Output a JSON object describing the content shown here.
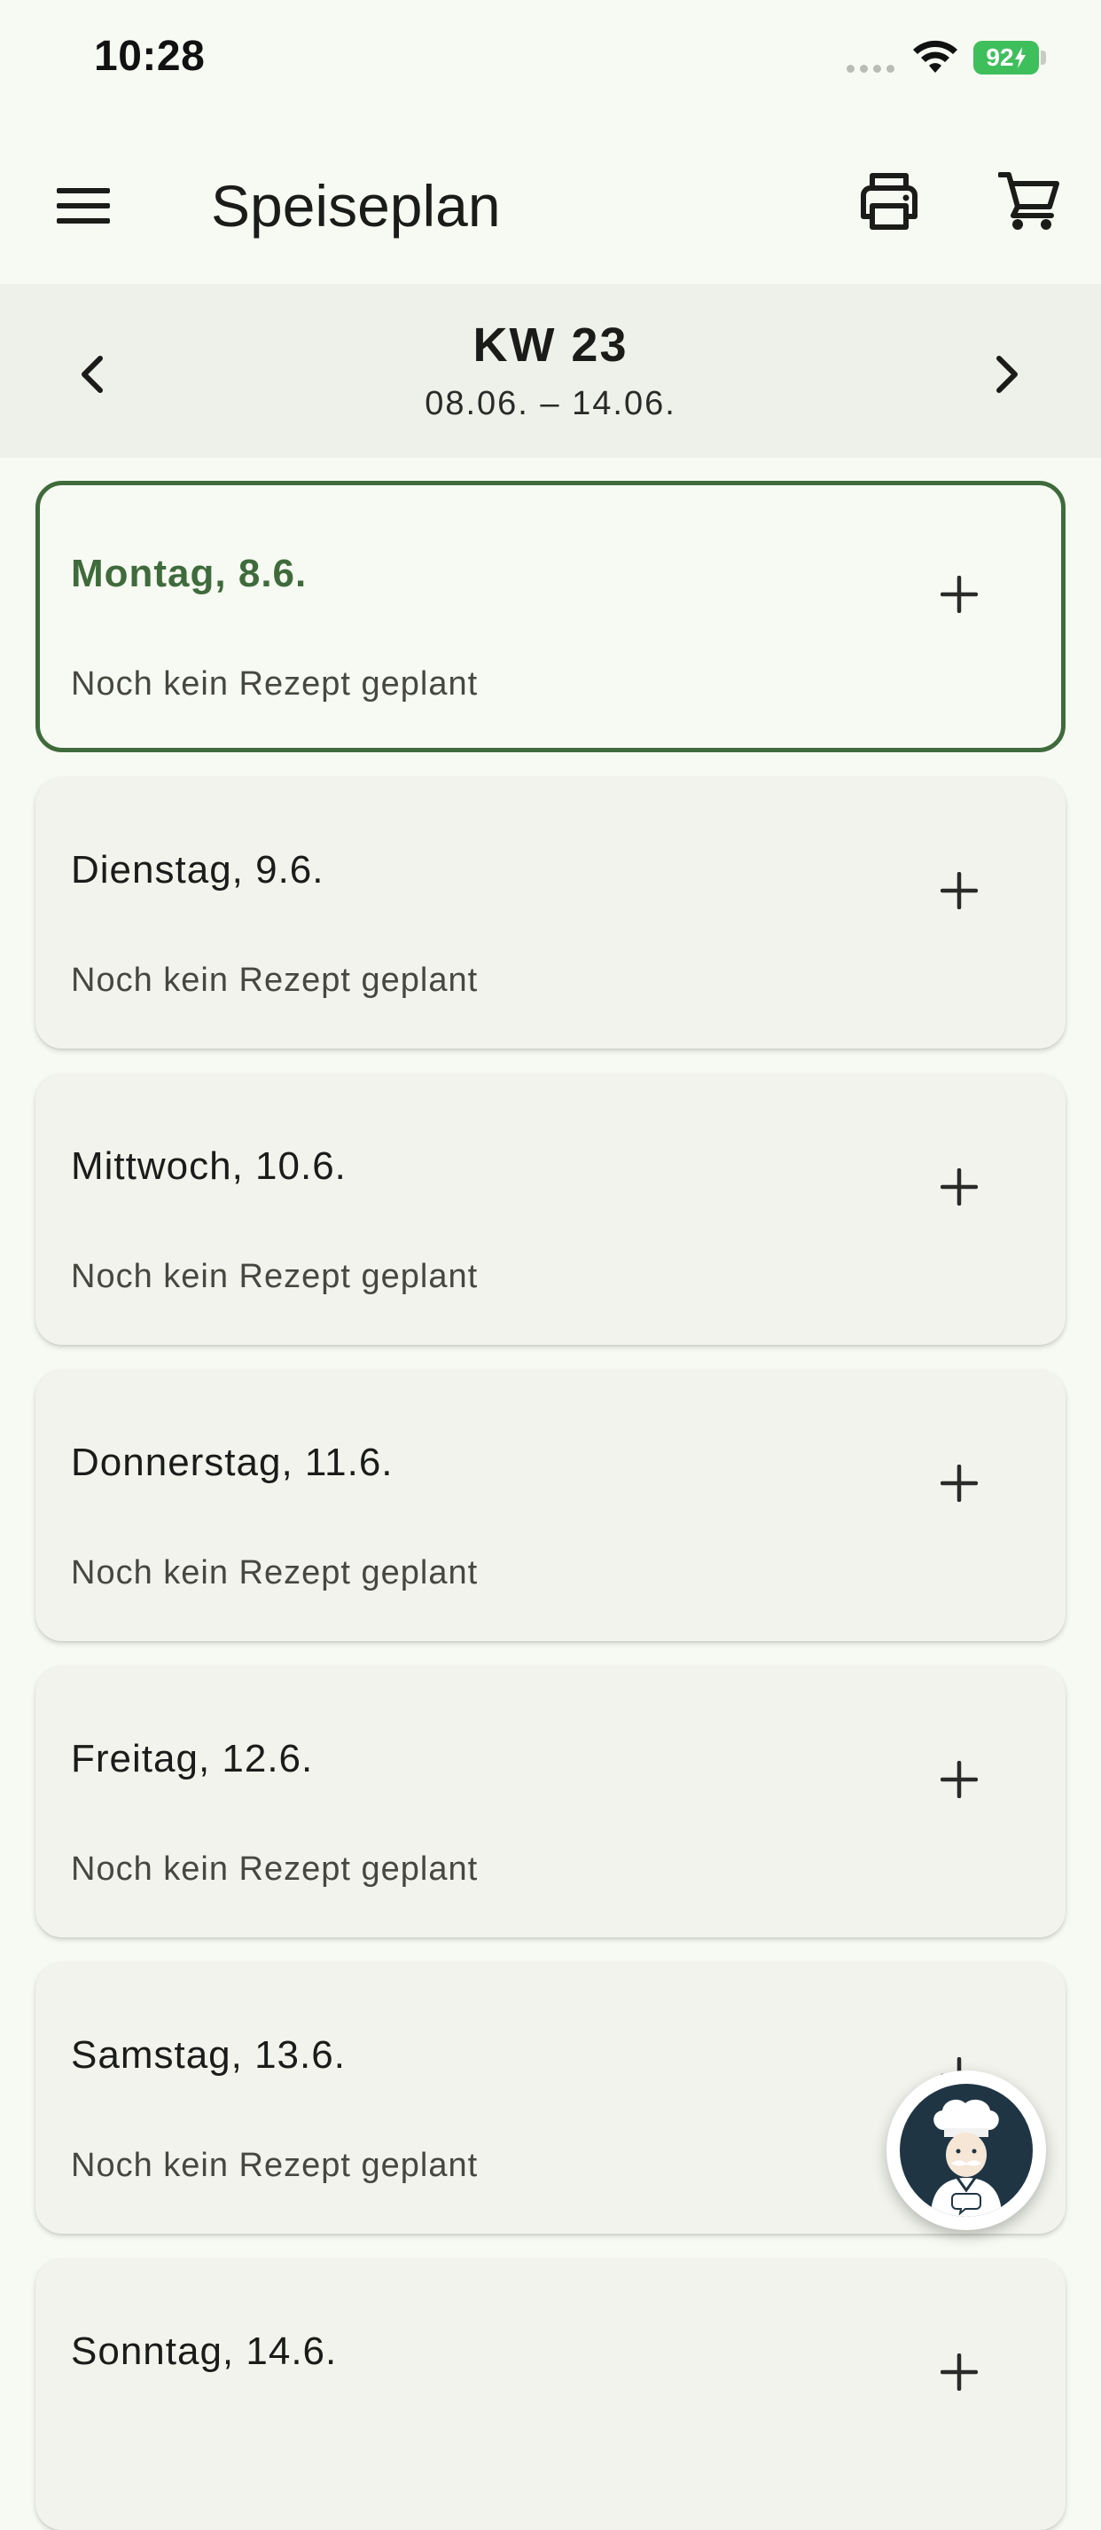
{
  "status_bar": {
    "time": "10:28",
    "battery": "92"
  },
  "app_bar": {
    "title": "Speiseplan",
    "menu_icon": "hamburger-menu-icon",
    "print_icon": "printer-icon",
    "cart_icon": "shopping-cart-icon"
  },
  "week": {
    "label": "KW 23",
    "range": "08.06. – 14.06."
  },
  "days": [
    {
      "title": "Montag, 8.6.",
      "status": "Noch kein Rezept geplant",
      "today": true
    },
    {
      "title": "Dienstag, 9.6.",
      "status": "Noch kein Rezept geplant",
      "today": false
    },
    {
      "title": "Mittwoch, 10.6.",
      "status": "Noch kein Rezept geplant",
      "today": false
    },
    {
      "title": "Donnerstag, 11.6.",
      "status": "Noch kein Rezept geplant",
      "today": false
    },
    {
      "title": "Freitag, 12.6.",
      "status": "Noch kein Rezept geplant",
      "today": false
    },
    {
      "title": "Samstag, 13.6.",
      "status": "Noch kein Rezept geplant",
      "today": false
    },
    {
      "title": "Sonntag, 14.6.",
      "status": "",
      "today": false
    }
  ],
  "colors": {
    "accent": "#3f6b3c",
    "background": "#f7faf2",
    "card": "#f1f3ec",
    "battery": "#3fbf5c"
  }
}
